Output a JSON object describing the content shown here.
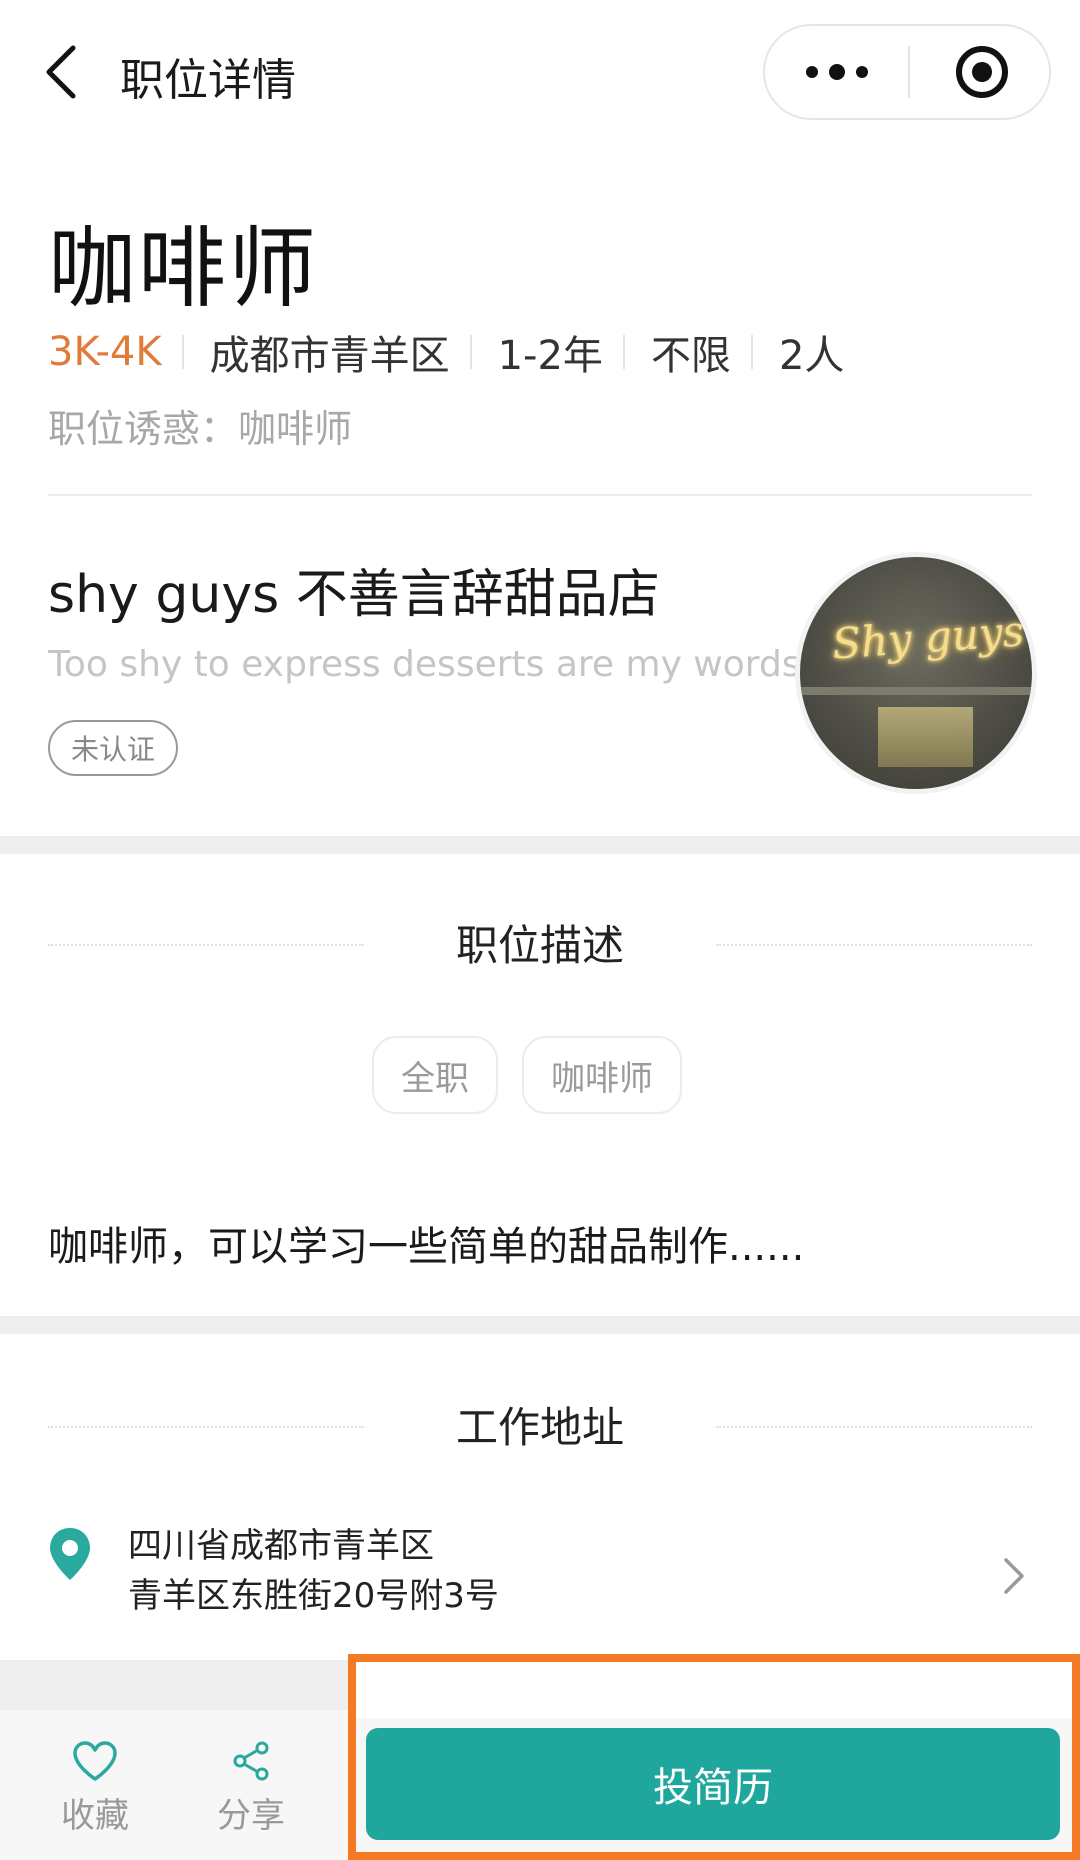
{
  "nav": {
    "title": "职位详情"
  },
  "job": {
    "title": "咖啡师",
    "salary": "3K-4K",
    "location": "成都市青羊区",
    "experience": "1-2年",
    "education": "不限",
    "headcount": "2人",
    "temptation": "职位诱惑：咖啡师"
  },
  "company": {
    "name": "shy guys 不善言辞甜品店",
    "slogan": "Too shy to express desserts are my words",
    "badge": "未认证",
    "logo_text": "Shy guys"
  },
  "description": {
    "heading": "职位描述",
    "tags": [
      "全职",
      "咖啡师"
    ],
    "text": "咖啡师，可以学习一些简单的甜品制作......"
  },
  "address": {
    "heading": "工作地址",
    "line1": "四川省成都市青羊区",
    "line2": "青羊区东胜街20号附3号"
  },
  "bottom": {
    "favorite_label": "收藏",
    "share_label": "分享",
    "apply_label": "投简历"
  },
  "colors": {
    "salary": "#e07b39",
    "accent": "#1fa79d",
    "highlight": "#f57a26"
  }
}
